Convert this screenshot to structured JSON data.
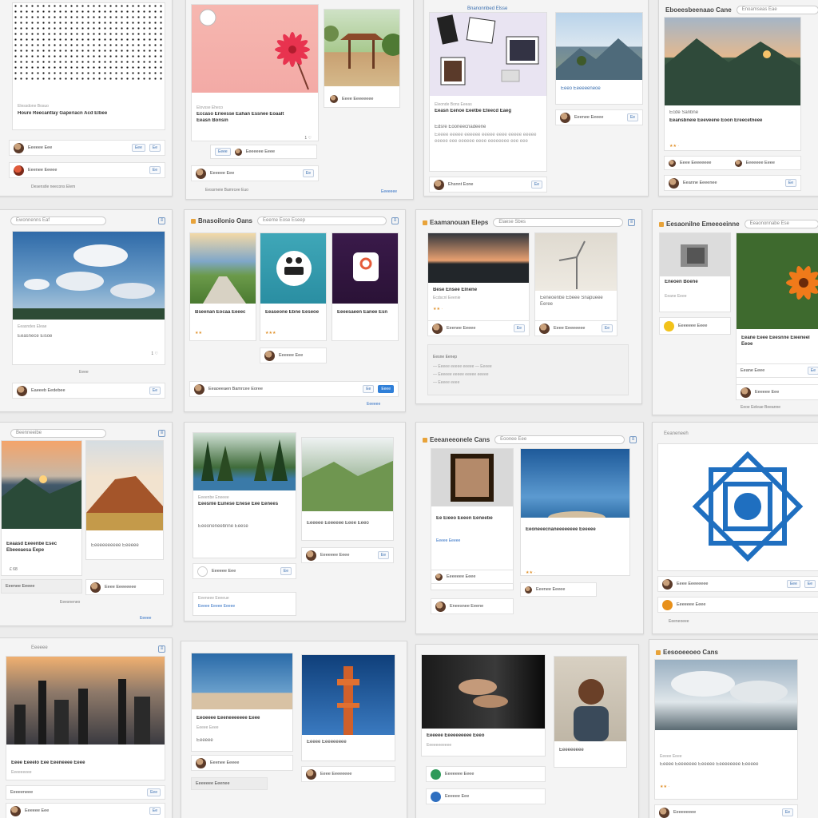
{
  "panels": [
    {
      "brand": "",
      "search": "",
      "captions": [
        "Houre Reecantlay Gaperiacn Acd Elbee"
      ],
      "sub": "Elessdone Bosuo",
      "foot": "Desenstle neecons  Elem"
    },
    {
      "brand": "",
      "search": "",
      "captions": [
        "Eccaso Erieesse Eahan Essnee Eoaalt",
        "Eeasn Bonsin"
      ],
      "sub": "Elovsse Eheco",
      "foot": "Eessrneie Bamrcee Euo"
    },
    {
      "brand": "",
      "search": "Bnanonnbed Elsse",
      "captions": [
        "Eeasn Eenoe Eeetbe Eteecd Eaeg",
        "Edsre Eooneecnadeene"
      ],
      "sub": "Eleonde Bons Eeeas",
      "foot": "Ehsnnt Eone"
    },
    {
      "brand": "Eboeesbeenaao Cane",
      "search": "Enoamseas Eae",
      "captions": [
        "Eeansbneie Eeeveene Eoon Ereecetneee"
      ],
      "sub": "Ecde Sanbne",
      "foot": "Eeanne Eeeenee"
    },
    {
      "brand": "",
      "search": "Ewonnenns Eaf",
      "captions": [
        "Eeasnece Eisoe"
      ],
      "sub": "Eeasndes Eleae",
      "foot": "Eaeeeb Eedebee"
    },
    {
      "brand": "Bnasoilonio Oans",
      "search": "Eeeme Eose Eseep",
      "captions": [
        "Bseenan Eocaa Eeeec",
        "Eeaseone Ebne Eeseoe",
        "Eeeesaeen Eanee Esn"
      ],
      "sub": "",
      "foot": "Eeaoeeaen Bamrcee Eoree"
    },
    {
      "brand": "Eaamanouan Eleps",
      "search": "Elaese Sbes",
      "captions": [
        "Bese Ensee Elnene",
        "Eeneoenbe Ebeee Snapueee Eeree"
      ],
      "sub": "Ecdscnl Eeenie",
      "foot": "Eesne Eenep"
    },
    {
      "brand": "Eesaonilne Emeeoeinne",
      "search": "Eeaononnabe Ese",
      "captions": [
        "Eneoen Boene",
        "Eeane Eeee Eeesnne Eieeneel Eeoe"
      ],
      "sub": "Eeane Eeee",
      "foot": "Eeoe Eeleae Beeanne"
    },
    {
      "brand": "",
      "search": "Beenneeibe",
      "captions": [
        "Eeaasd Eeeenbe Esec Ebeeeaesa Eepe"
      ],
      "sub": "",
      "foot": "Eeesneneo"
    },
    {
      "brand": "",
      "search": "",
      "captions": [
        "Eeesnle Eunese Enese Eee Eenees",
        "Eeeoneneebnne Eeese"
      ],
      "sub": "Eeeenbe Eneeee",
      "foot": "Eeeneee Eeeeue"
    },
    {
      "brand": "Eeeaneeonele Cans",
      "search": "Eoonee Eee",
      "captions": [
        "Ee Eieeo Eeeen Eeneebe",
        "Eeoneeecnaneeeeeeee Eeeeee"
      ],
      "sub": "Eeeeeee Eeee",
      "foot": "Eneesnee Eeene"
    },
    {
      "brand": "",
      "search": "Eeaneneeh",
      "captions": [],
      "sub": "",
      "foot": "Eeeneoeee"
    },
    {
      "brand": "",
      "search": "",
      "captions": [
        "Eeee Eeeelo Eee Eeeneeee Eeee"
      ],
      "sub": "Eeeeeeeee",
      "foot": "Eeeeeneee"
    },
    {
      "brand": "",
      "search": "",
      "captions": [
        "Eeoeeee Eeeneeeeeee Eeee",
        "Eeeeee"
      ],
      "sub": "Eeeee Eeee",
      "foot": "Eeeeeee Eeenee"
    },
    {
      "brand": "",
      "search": "",
      "captions": [
        "Eeeeee Eeeeeeeeee Eeeo"
      ],
      "sub": "Eeeeeeeeeee",
      "foot": "Eeeeeeeee"
    },
    {
      "brand": "Eesooeeoeo Cans",
      "search": "",
      "captions": [
        "Eeeee Eeeeeeee Eeeeee Eeeeeeeee Eeeeee"
      ],
      "sub": "Eeeee Eeee",
      "foot": "Eeeeeeeee"
    }
  ],
  "rows": [
    "Eeeeee Eee",
    "Eeenee Eeeee",
    "Eeee Eeeeeeee",
    "Eeeeeee Eeee"
  ],
  "buttons": {
    "follow": "Eeee",
    "share": "Eee",
    "save": "Ee"
  },
  "accent": "#2f7fd8",
  "star": "#e8a33a"
}
